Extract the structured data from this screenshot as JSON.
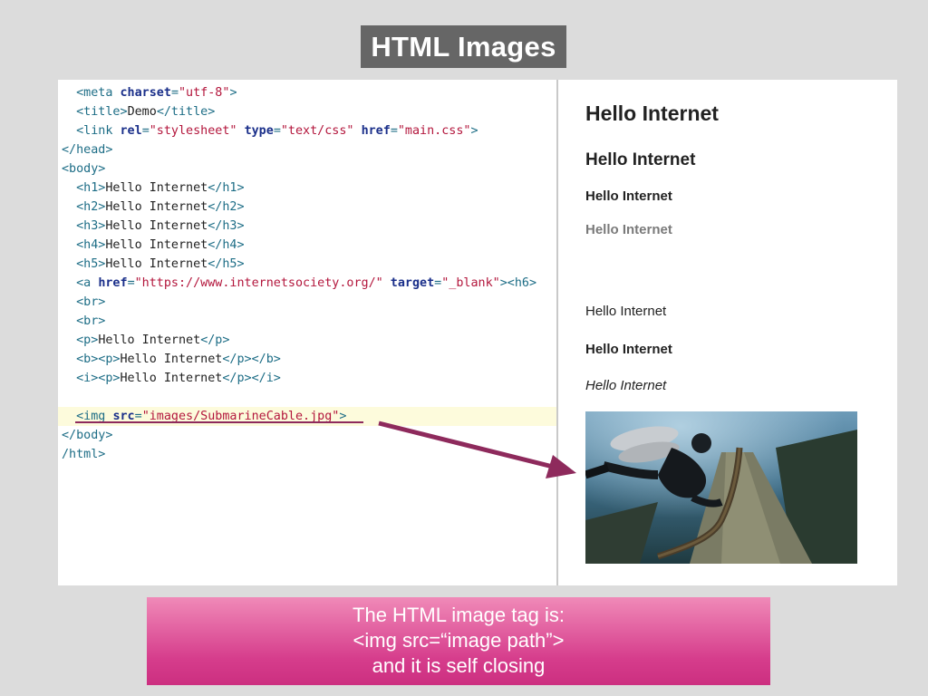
{
  "slide": {
    "title": "HTML Images",
    "caption": {
      "line1": "The HTML image tag is:",
      "line2": "<img src=“image path”>",
      "line3": "and it is self closing"
    }
  },
  "code_lines": [
    [
      {
        "t": "tag",
        "s": "  <meta "
      },
      {
        "t": "attr",
        "s": "charset"
      },
      {
        "t": "tag",
        "s": "="
      },
      {
        "t": "val",
        "s": "\"utf-8\""
      },
      {
        "t": "tag",
        "s": ">"
      }
    ],
    [
      {
        "t": "tag",
        "s": "  <title>"
      },
      {
        "t": "txt",
        "s": "Demo"
      },
      {
        "t": "tag",
        "s": "</title>"
      }
    ],
    [
      {
        "t": "tag",
        "s": "  <link "
      },
      {
        "t": "attr",
        "s": "rel"
      },
      {
        "t": "tag",
        "s": "="
      },
      {
        "t": "val",
        "s": "\"stylesheet\""
      },
      {
        "t": "tag",
        "s": " "
      },
      {
        "t": "attr",
        "s": "type"
      },
      {
        "t": "tag",
        "s": "="
      },
      {
        "t": "val",
        "s": "\"text/css\""
      },
      {
        "t": "tag",
        "s": " "
      },
      {
        "t": "attr",
        "s": "href"
      },
      {
        "t": "tag",
        "s": "="
      },
      {
        "t": "val",
        "s": "\"main.css\""
      },
      {
        "t": "tag",
        "s": ">"
      }
    ],
    [
      {
        "t": "tag",
        "s": "</head>"
      }
    ],
    [
      {
        "t": "tag",
        "s": "<body>"
      }
    ],
    [
      {
        "t": "tag",
        "s": "  <h1>"
      },
      {
        "t": "txt",
        "s": "Hello Internet"
      },
      {
        "t": "tag",
        "s": "</h1>"
      }
    ],
    [
      {
        "t": "tag",
        "s": "  <h2>"
      },
      {
        "t": "txt",
        "s": "Hello Internet"
      },
      {
        "t": "tag",
        "s": "</h2>"
      }
    ],
    [
      {
        "t": "tag",
        "s": "  <h3>"
      },
      {
        "t": "txt",
        "s": "Hello Internet"
      },
      {
        "t": "tag",
        "s": "</h3>"
      }
    ],
    [
      {
        "t": "tag",
        "s": "  <h4>"
      },
      {
        "t": "txt",
        "s": "Hello Internet"
      },
      {
        "t": "tag",
        "s": "</h4>"
      }
    ],
    [
      {
        "t": "tag",
        "s": "  <h5>"
      },
      {
        "t": "txt",
        "s": "Hello Internet"
      },
      {
        "t": "tag",
        "s": "</h5>"
      }
    ],
    [
      {
        "t": "tag",
        "s": "  <a "
      },
      {
        "t": "attr",
        "s": "href"
      },
      {
        "t": "tag",
        "s": "="
      },
      {
        "t": "val",
        "s": "\"https://www.internetsociety.org/\""
      },
      {
        "t": "tag",
        "s": " "
      },
      {
        "t": "attr",
        "s": "target"
      },
      {
        "t": "tag",
        "s": "="
      },
      {
        "t": "val",
        "s": "\"_blank\""
      },
      {
        "t": "tag",
        "s": "><h6>"
      }
    ],
    [
      {
        "t": "tag",
        "s": "  <br>"
      }
    ],
    [
      {
        "t": "tag",
        "s": "  <br>"
      }
    ],
    [
      {
        "t": "tag",
        "s": "  <p>"
      },
      {
        "t": "txt",
        "s": "Hello Internet"
      },
      {
        "t": "tag",
        "s": "</p>"
      }
    ],
    [
      {
        "t": "tag",
        "s": "  <b><p>"
      },
      {
        "t": "txt",
        "s": "Hello Internet"
      },
      {
        "t": "tag",
        "s": "</p></b>"
      }
    ],
    [
      {
        "t": "tag",
        "s": "  <i><p>"
      },
      {
        "t": "txt",
        "s": "Hello Internet"
      },
      {
        "t": "tag",
        "s": "</p></i>"
      }
    ],
    [],
    [
      {
        "t": "tag",
        "s": "  <img "
      },
      {
        "t": "attr",
        "s": "src"
      },
      {
        "t": "tag",
        "s": "="
      },
      {
        "t": "val",
        "s": "\"images/SubmarineCable.jpg\""
      },
      {
        "t": "tag",
        "s": ">"
      }
    ],
    [
      {
        "t": "tag",
        "s": "</body>"
      }
    ],
    [
      {
        "t": "tag",
        "s": "/html>"
      }
    ]
  ],
  "highlighted_line": 17,
  "preview": {
    "h1": "Hello Internet",
    "h2": "Hello Internet",
    "h3": "Hello Internet",
    "h4": "Hello Internet",
    "p": "Hello Internet",
    "b": "Hello Internet",
    "i": "Hello Internet"
  },
  "colors": {
    "tag": "#1d6d86",
    "attribute": "#1a2f8a",
    "value": "#b3163c",
    "arrow": "#8e2a5c",
    "caption_top": "#f08ab8",
    "caption_bottom": "#cc2f80"
  }
}
